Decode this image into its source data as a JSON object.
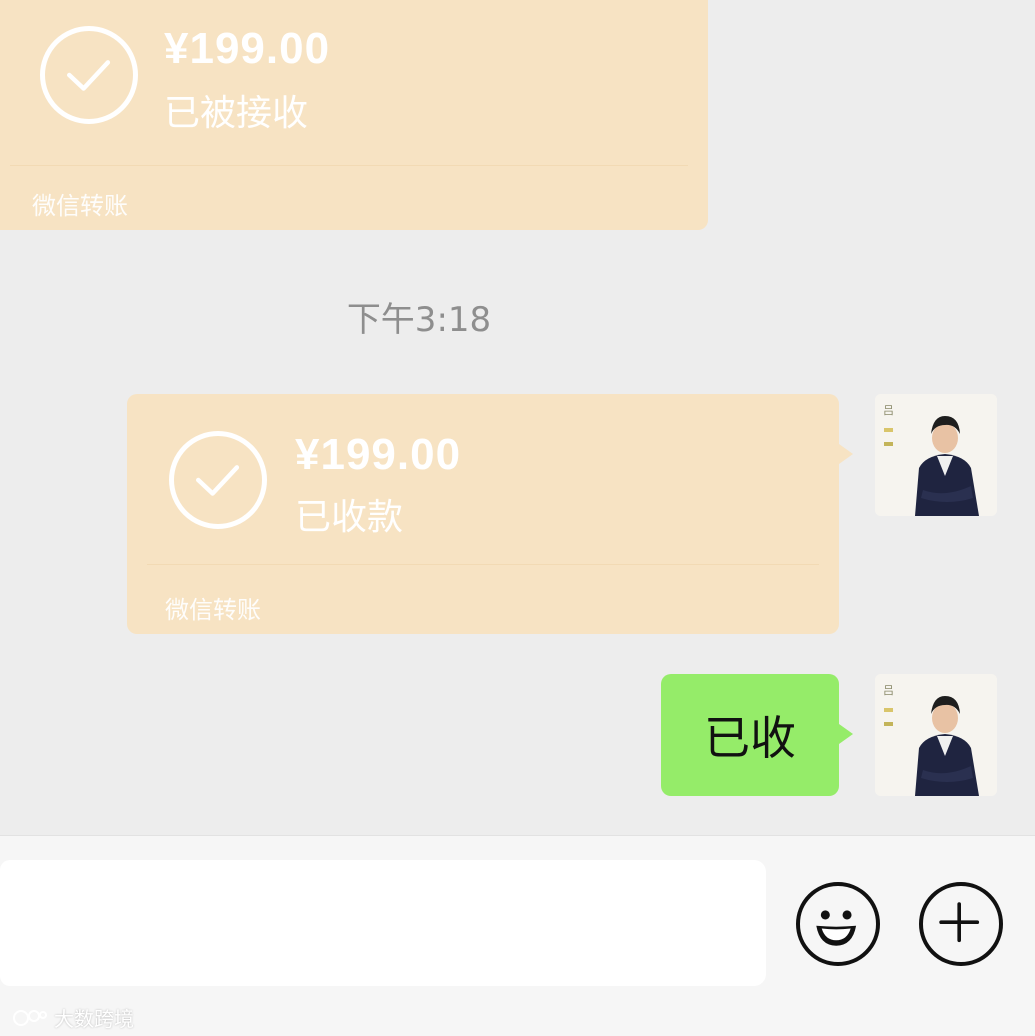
{
  "messages": {
    "first_transfer": {
      "amount": "¥199.00",
      "status": "已被接收",
      "footer": "微信转账"
    },
    "timestamp": "下午3:18",
    "second_transfer": {
      "amount": "¥199.00",
      "status": "已收款",
      "footer": "微信转账"
    },
    "text_message": "已收"
  },
  "input": {
    "value": "",
    "emoji_icon": "emoji-icon",
    "plus_icon": "plus-icon"
  },
  "watermark": "大数跨境",
  "colors": {
    "chat_bg": "#ededed",
    "transfer_card": "#f7e3c3",
    "text_bubble": "#95ec69",
    "input_bar": "#f6f6f6"
  }
}
